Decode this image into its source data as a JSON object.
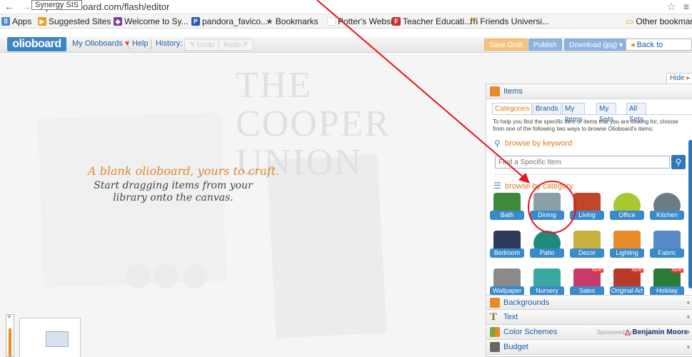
{
  "browser": {
    "tooltip": "Synergy SIS",
    "url": "ps://olioboard.com/flash/editor",
    "bookmarks": [
      {
        "label": "Apps",
        "color": "#4a87d6"
      },
      {
        "label": "Suggested Sites",
        "color": "#f39b1c"
      },
      {
        "label": "Welcome to Sy...",
        "color": "#7a3e9d"
      },
      {
        "label": "pandora_favico...",
        "color": "#2856b8"
      },
      {
        "label": "Bookmarks",
        "color": "#666666"
      },
      {
        "label": "Potter's Website",
        "color": "#ffffff"
      },
      {
        "label": "Teacher Educati...",
        "color": "#c8322e"
      },
      {
        "label": "Friends Universi...",
        "color": "#7b5a1e"
      },
      {
        "label": "Other bookmark",
        "color": "#f0c24a"
      }
    ]
  },
  "toolbar": {
    "logo": "olioboard",
    "my_olioboards": "My Olioboards",
    "help": "Help",
    "history": "History:",
    "undo": "Undo",
    "redo": "Redo",
    "save_draft": "Save Draft",
    "publish": "Publish",
    "download": "Download (jpg)",
    "back": "Back to Community"
  },
  "canvas": {
    "bg_text": "THE COOPER UNION",
    "title": "A blank olioboard, yours to craft.",
    "subtitle": "Start dragging items from your library onto the canvas.",
    "zoom_level": 0.7
  },
  "panel": {
    "hide": "Hide",
    "items_title": "Items",
    "tabs": [
      "Categories",
      "Brands",
      "My Items",
      "My Sets",
      "All Sets"
    ],
    "help_text": "To help you find the specific item or items that you are looking for, choose from one of the following two ways to browse Olioboard's items:",
    "keyword_title": "browse by keyword",
    "search_placeholder": "Find a Specific Item",
    "category_title": "browse by category",
    "categories": [
      {
        "label": "Bath",
        "color": "#3f8a3a",
        "new": ""
      },
      {
        "label": "Dining",
        "color": "#8aa0a8",
        "new": ""
      },
      {
        "label": "Living",
        "color": "#c2462a",
        "new": ""
      },
      {
        "label": "Office",
        "color": "#a8c832",
        "new": ""
      },
      {
        "label": "Kitchen",
        "color": "#6a7c84",
        "new": ""
      },
      {
        "label": "Bedroom",
        "color": "#2d3a5a",
        "new": ""
      },
      {
        "label": "Patio",
        "color": "#1e8a7a",
        "new": ""
      },
      {
        "label": "Decor",
        "color": "#c8b040",
        "new": ""
      },
      {
        "label": "Lighting",
        "color": "#e8892a",
        "new": ""
      },
      {
        "label": "Fabric",
        "color": "#5a8ac8",
        "new": ""
      },
      {
        "label": "Wallpaper",
        "color": "#8a8a8a",
        "new": ""
      },
      {
        "label": "Nursery",
        "color": "#3aa8a0",
        "new": ""
      },
      {
        "label": "Sales",
        "color": "#c83a6a",
        "new": "NEW"
      },
      {
        "label": "Original Art",
        "color": "#b83a2a",
        "new": "NEW"
      },
      {
        "label": "Holiday",
        "color": "#2a7a3a",
        "new": "NEW"
      }
    ],
    "sections": [
      {
        "label": "Backgrounds",
        "color": "#e8892a"
      },
      {
        "label": "Text",
        "color": "#8a6a2a"
      },
      {
        "label": "Color Schemes",
        "color": "#7aa83a"
      },
      {
        "label": "Budget",
        "color": "#666666"
      }
    ],
    "sponsored_by": "Sponsored by:",
    "sponsor_name": "Benjamin Moore"
  }
}
